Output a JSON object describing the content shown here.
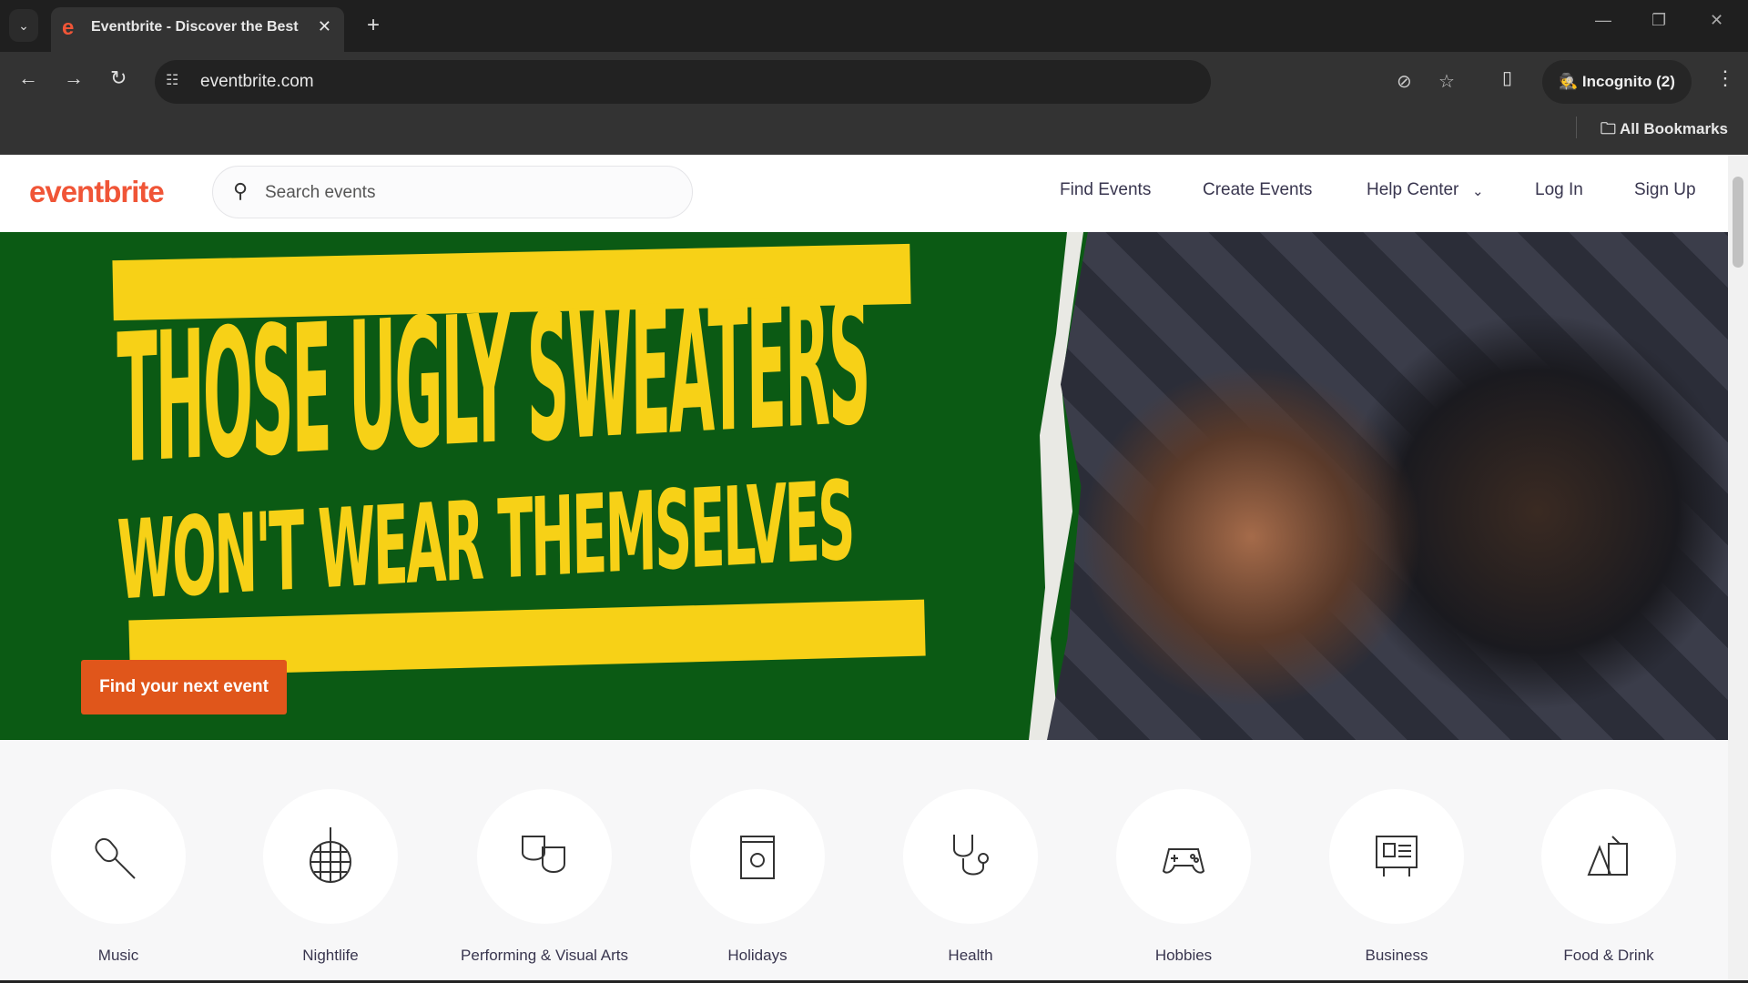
{
  "browser": {
    "tab_title": "Eventbrite - Discover the Best Local Events & Things to Do",
    "url": "eventbrite.com",
    "incognito_label": "Incognito (2)",
    "bookmarks_label": "All Bookmarks"
  },
  "header": {
    "logo": "eventbrite",
    "search_placeholder": "Search events",
    "nav": [
      "Find Events",
      "Create Events",
      "Help Center",
      "Log In",
      "Sign Up"
    ]
  },
  "hero": {
    "line1": "THOSE UGLY SWEATERS",
    "line2": "WON'T WEAR THEMSELVES",
    "cta": "Find your next event",
    "colors": {
      "background": "#0b5a14",
      "headline": "#f7d117",
      "cta": "#e0561b"
    }
  },
  "categories": [
    {
      "label": "Music",
      "icon": "microphone-icon"
    },
    {
      "label": "Nightlife",
      "icon": "disco-ball-icon"
    },
    {
      "label": "Performing & Visual Arts",
      "icon": "theater-masks-icon"
    },
    {
      "label": "Holidays",
      "icon": "calendar-sun-icon"
    },
    {
      "label": "Health",
      "icon": "stethoscope-icon"
    },
    {
      "label": "Hobbies",
      "icon": "gamepad-icon"
    },
    {
      "label": "Business",
      "icon": "presentation-board-icon"
    },
    {
      "label": "Food & Drink",
      "icon": "food-drink-icon"
    }
  ]
}
